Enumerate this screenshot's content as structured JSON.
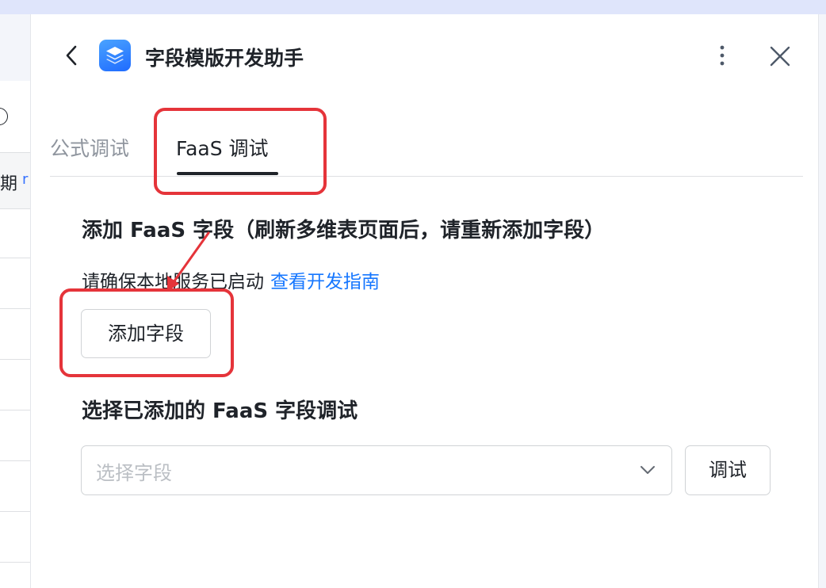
{
  "header": {
    "title": "字段模版开发助手"
  },
  "tabs": [
    {
      "label": "公式调试",
      "active": false
    },
    {
      "label": "FaaS 调试",
      "active": true
    }
  ],
  "add_section": {
    "heading": "添加 FaaS 字段（刷新多维表页面后，请重新添加字段）",
    "hint": "请确保本地服务已启动",
    "guide_link": "查看开发指南",
    "add_button": "添加字段"
  },
  "select_section": {
    "heading": "选择已添加的 FaaS 字段调试",
    "select_placeholder": "选择字段",
    "debug_button": "调试"
  },
  "background": {
    "partial_text": "期"
  },
  "colors": {
    "accent": "#1677ff",
    "highlight": "#e5343a",
    "icon_top": "#4aa3ff",
    "icon_bottom": "#1f6bff"
  },
  "icons": [
    "chevron-left-icon",
    "app-layers-icon",
    "more-vertical-icon",
    "close-icon",
    "chevron-down-icon"
  ]
}
